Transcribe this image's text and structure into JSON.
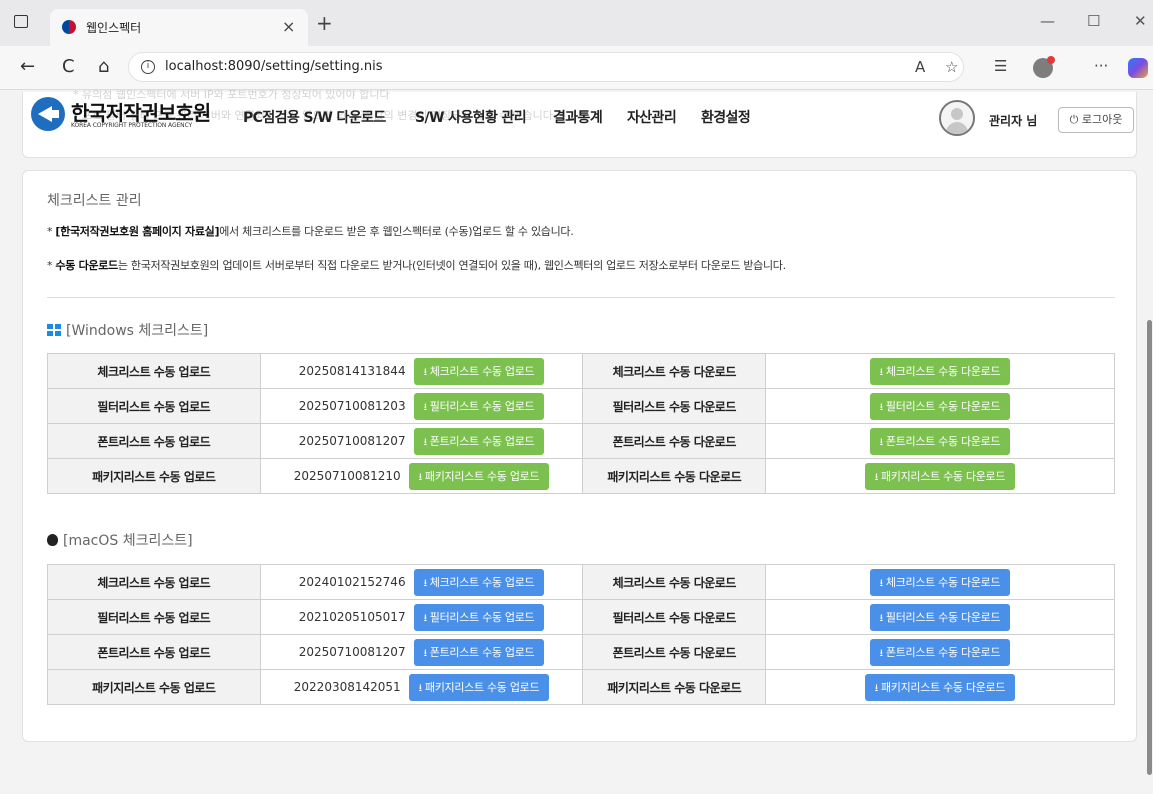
{
  "browser": {
    "tab_title": "웹인스펙터",
    "url": "localhost:8090/setting/setting.nis",
    "tab_close": "×",
    "new_tab": "+",
    "minimize": "—",
    "maximize": "☐",
    "close": "✕",
    "back": "←",
    "reload": "C",
    "home": "⌂",
    "info": "i",
    "read_aloud": "A",
    "favorite": "☆",
    "favorites": "☰",
    "more": "···"
  },
  "header": {
    "logo_text": "한국저작권보호원",
    "logo_sub": "KOREA COPYRIGHT PROTECTION AGENCY",
    "ghost_line_1": "* 유의점 웹인스펙터에 서버 IP와 포트번호가 정상되어 있어야 합니다",
    "ghost_line_2": "* 프로 필터 필터 프로 관리 서버와 연결되어 있지 않으면 의 설정 값의 변경이 저장되지 않을 수 있습니다",
    "menu": [
      {
        "label": "PC점검용 S/W 다운로드"
      },
      {
        "label": "S/W 사용현황 관리"
      },
      {
        "label": "결과통계"
      },
      {
        "label": "자산관리"
      },
      {
        "label": "환경설정"
      }
    ],
    "user_name": "관리자 님",
    "logout_label": "⏻ 로그아웃"
  },
  "checklist": {
    "title": "체크리스트 관리",
    "note1_bold": "[한국저작권보호원 홈페이지 자료실]",
    "note1_rest": "에서 체크리스트를 다운로드 받은 후 웹인스펙터로 (수동)업로드 할 수 있습니다.",
    "note2_bold": "수동 다운로드",
    "note2_rest": "는 한국저작권보호원의 업데이트 서버로부터 직접 다운로드 받거나(인터넷이 연결되어 있을 때), 웹인스펙터의 업로드 저장소로부터 다운로드 받습니다.",
    "bullet": "* "
  },
  "windows": {
    "title": "[Windows 체크리스트]",
    "accent": "#7cc150",
    "rows": [
      {
        "upload_label": "체크리스트 수동 업로드",
        "date": "20250814131844",
        "upload_btn": "체크리스트 수동 업로드",
        "download_label": "체크리스트 수동 다운로드",
        "download_btn": "체크리스트 수동 다운로드"
      },
      {
        "upload_label": "필터리스트 수동 업로드",
        "date": "20250710081203",
        "upload_btn": "필터리스트 수동 업로드",
        "download_label": "필터리스트 수동 다운로드",
        "download_btn": "필터리스트 수동 다운로드"
      },
      {
        "upload_label": "폰트리스트 수동 업로드",
        "date": "20250710081207",
        "upload_btn": "폰트리스트 수동 업로드",
        "download_label": "폰트리스트 수동 다운로드",
        "download_btn": "폰트리스트 수동 다운로드"
      },
      {
        "upload_label": "패키지리스트 수동 업로드",
        "date": "20250710081210",
        "upload_btn": "패키지리스트 수동 업로드",
        "download_label": "패키지리스트 수동 다운로드",
        "download_btn": "패키지리스트 수동 다운로드"
      }
    ]
  },
  "macos": {
    "title": "[macOS 체크리스트]",
    "accent": "#4a8fe8",
    "rows": [
      {
        "upload_label": "체크리스트 수동 업로드",
        "date": "20240102152746",
        "upload_btn": "체크리스트 수동 업로드",
        "download_label": "체크리스트 수동 다운로드",
        "download_btn": "체크리스트 수동 다운로드"
      },
      {
        "upload_label": "필터리스트 수동 업로드",
        "date": "20210205105017",
        "upload_btn": "필터리스트 수동 업로드",
        "download_label": "필터리스트 수동 다운로드",
        "download_btn": "필터리스트 수동 다운로드"
      },
      {
        "upload_label": "폰트리스트 수동 업로드",
        "date": "20250710081207",
        "upload_btn": "폰트리스트 수동 업로드",
        "download_label": "폰트리스트 수동 다운로드",
        "download_btn": "폰트리스트 수동 다운로드"
      },
      {
        "upload_label": "패키지리스트 수동 업로드",
        "date": "20220308142051",
        "upload_btn": "패키지리스트 수동 업로드",
        "download_label": "패키지리스트 수동 다운로드",
        "download_btn": "패키지리스트 수동 다운로드"
      }
    ]
  }
}
